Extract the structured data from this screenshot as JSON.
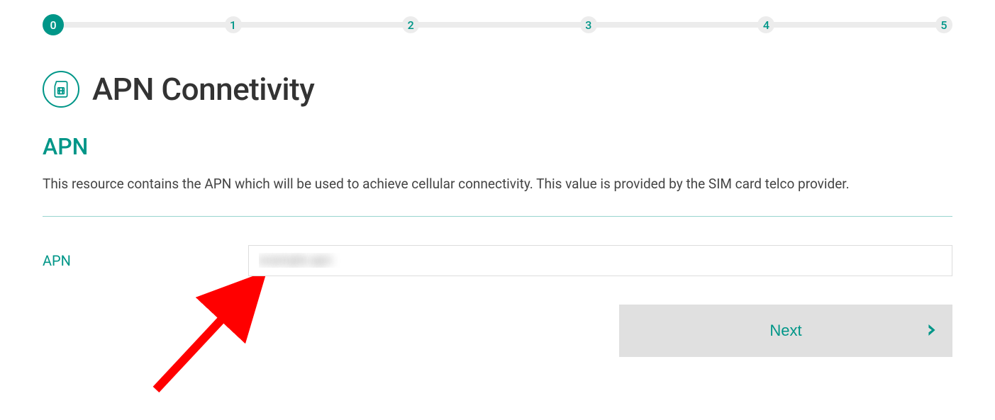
{
  "stepper": {
    "steps": [
      "0",
      "1",
      "2",
      "3",
      "4",
      "5"
    ],
    "active_index": 0
  },
  "header": {
    "title": "APN Connetivity"
  },
  "section": {
    "heading": "APN",
    "description": "This resource contains the APN which will be used to achieve cellular connectivity. This value is provided by the SIM card telco provider."
  },
  "form": {
    "apn_label": "APN",
    "apn_value": "example.apn"
  },
  "actions": {
    "next_label": "Next"
  },
  "colors": {
    "accent": "#009688",
    "track": "#ececec",
    "text_dark": "#333333",
    "btn_bg": "#e0e0e0",
    "arrow": "#ff0000"
  }
}
